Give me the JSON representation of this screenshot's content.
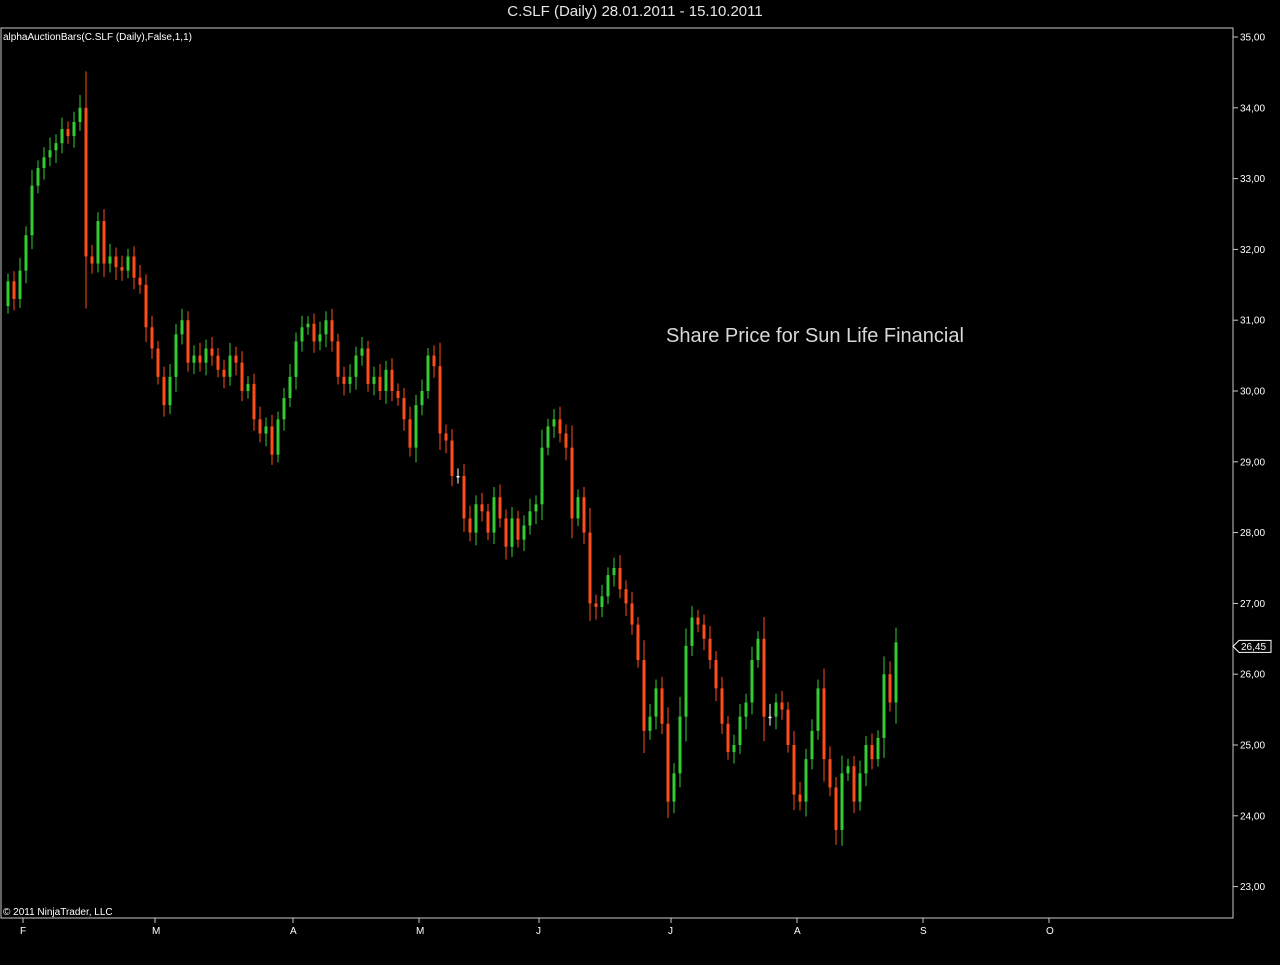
{
  "window": {
    "title": "C.SLF (Daily)  28.01.2011 - 15.10.2011"
  },
  "indicator_label": "alphaAuctionBars(C.SLF (Daily),False,1,1)",
  "copyright": "© 2011 NinjaTrader, LLC",
  "annotation": "Share Price for Sun Life Financial",
  "colors": {
    "background": "#000000",
    "up": "#33cc33",
    "down": "#ff4d1a",
    "neutral": "#ffffff",
    "axis": "#c8c8c8"
  },
  "chart_data": {
    "type": "candlestick",
    "title": "C.SLF (Daily)  28.01.2011 - 15.10.2011",
    "ylim": [
      22.7,
      35.1
    ],
    "y_ticks": [
      "23,00",
      "24,00",
      "25,00",
      "26,00",
      "27,00",
      "28,00",
      "29,00",
      "30,00",
      "31,00",
      "32,00",
      "33,00",
      "34,00",
      "35,00"
    ],
    "x_ticks": [
      "F",
      "M",
      "A",
      "M",
      "J",
      "J",
      "A",
      "S",
      "O"
    ],
    "x_tick_bar_index": [
      1,
      23,
      46,
      67,
      87,
      109,
      130,
      151,
      172
    ],
    "last_price": "26,45",
    "grid": false,
    "close": [
      31.55,
      31.3,
      31.7,
      32.2,
      32.9,
      33.15,
      33.3,
      33.4,
      33.5,
      33.7,
      33.6,
      33.8,
      34.0,
      31.9,
      31.8,
      32.4,
      31.8,
      31.9,
      31.75,
      31.7,
      31.9,
      31.6,
      31.5,
      30.9,
      30.6,
      30.2,
      29.8,
      30.2,
      30.8,
      31.0,
      30.4,
      30.5,
      30.4,
      30.6,
      30.5,
      30.3,
      30.2,
      30.5,
      30.4,
      30.0,
      30.1,
      29.6,
      29.4,
      29.5,
      29.1,
      29.6,
      29.9,
      30.2,
      30.7,
      30.9,
      30.95,
      30.7,
      30.8,
      31.0,
      30.7,
      30.2,
      30.1,
      30.2,
      30.5,
      30.6,
      30.1,
      30.2,
      30.0,
      30.3,
      30.0,
      29.9,
      29.6,
      29.2,
      29.8,
      30.0,
      30.5,
      30.35,
      29.4,
      29.3,
      28.8,
      28.8,
      28.2,
      28.0,
      28.4,
      28.3,
      28.0,
      28.5,
      28.2,
      27.8,
      28.2,
      27.9,
      28.1,
      28.3,
      28.4,
      29.2,
      29.5,
      29.6,
      29.4,
      29.2,
      28.2,
      28.5,
      28.0,
      27.0,
      26.95,
      27.1,
      27.4,
      27.5,
      27.2,
      27.0,
      26.7,
      26.2,
      25.2,
      25.4,
      25.8,
      25.3,
      24.2,
      24.6,
      25.4,
      26.4,
      26.8,
      26.7,
      26.5,
      26.2,
      25.8,
      25.3,
      24.9,
      25.0,
      25.4,
      25.6,
      26.2,
      26.5,
      25.4,
      25.4,
      25.6,
      25.5,
      25.0,
      24.3,
      24.2,
      24.8,
      25.2,
      25.8,
      24.8,
      24.4,
      23.8,
      24.6,
      24.7,
      24.2,
      24.6,
      25.0,
      24.8,
      25.1,
      26.0,
      25.6,
      26.45
    ],
    "open": [
      31.2,
      31.55,
      31.3,
      31.7,
      32.2,
      32.9,
      33.15,
      33.3,
      33.4,
      33.5,
      33.7,
      33.6,
      33.8,
      34.0,
      31.9,
      31.8,
      32.4,
      31.8,
      31.9,
      31.75,
      31.7,
      31.9,
      31.6,
      31.5,
      30.9,
      30.6,
      30.2,
      29.8,
      30.2,
      30.8,
      31.0,
      30.4,
      30.5,
      30.4,
      30.6,
      30.5,
      30.3,
      30.2,
      30.5,
      30.4,
      30.0,
      30.1,
      29.6,
      29.4,
      29.5,
      29.1,
      29.6,
      29.9,
      30.2,
      30.7,
      30.9,
      30.95,
      30.7,
      30.8,
      31.0,
      30.7,
      30.2,
      30.1,
      30.2,
      30.5,
      30.6,
      30.1,
      30.2,
      30.0,
      30.3,
      30.0,
      29.9,
      29.6,
      29.2,
      29.8,
      30.0,
      30.5,
      30.35,
      29.4,
      29.3,
      28.8,
      28.8,
      28.2,
      28.0,
      28.4,
      28.3,
      28.0,
      28.5,
      28.2,
      27.8,
      28.2,
      27.9,
      28.1,
      28.3,
      28.4,
      29.2,
      29.5,
      29.6,
      29.4,
      29.2,
      28.2,
      28.5,
      28.0,
      27.0,
      26.95,
      27.1,
      27.4,
      27.5,
      27.2,
      27.0,
      26.7,
      26.2,
      25.2,
      25.4,
      25.8,
      25.3,
      24.2,
      24.6,
      25.4,
      26.4,
      26.8,
      26.7,
      26.5,
      26.2,
      25.8,
      25.3,
      24.9,
      25.0,
      25.4,
      25.6,
      26.2,
      26.5,
      25.4,
      25.4,
      25.6,
      25.5,
      25.0,
      24.3,
      24.2,
      24.8,
      25.2,
      25.8,
      24.8,
      24.4,
      23.8,
      24.6,
      24.7,
      24.2,
      24.6,
      25.0,
      24.8,
      25.1,
      26.0,
      25.6
    ]
  }
}
